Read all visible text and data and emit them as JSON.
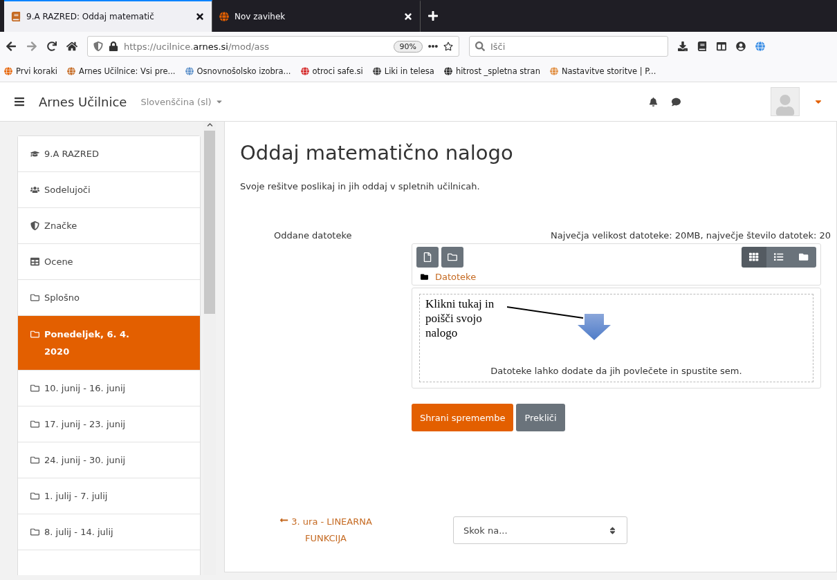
{
  "browser": {
    "tabs": [
      {
        "title": "9.A RAZRED: Oddaj matematič",
        "selected": true
      },
      {
        "title": "Nov zavihek",
        "selected": false
      }
    ],
    "address": {
      "prefix": "https://ucilnice.",
      "domain": "arnes.si",
      "path": "/mod/ass"
    },
    "zoom": "90%",
    "search": {
      "placeholder": "Išči"
    },
    "bookmarks": [
      "Prvi koraki",
      "Arnes Učilnice: Vsi pre...",
      "Osnovnošolsko izobra...",
      "otroci safe.si",
      "Liki in telesa",
      "hitrost _spletna stran",
      "Nastavitve storitve | P..."
    ]
  },
  "navbar": {
    "site_name": "Arnes Učilnice",
    "language": "Slovenščina (sl)"
  },
  "sidebar": {
    "items": [
      {
        "label": "9.A RAZRED",
        "kind": "course",
        "selected": false
      },
      {
        "label": "Sodelujoči",
        "kind": "participants",
        "selected": false
      },
      {
        "label": "Značke",
        "kind": "badges",
        "selected": false
      },
      {
        "label": "Ocene",
        "kind": "grades",
        "selected": false
      },
      {
        "label": "Splošno",
        "kind": "section",
        "selected": false
      },
      {
        "label": "Ponedeljek, 6. 4. 2020",
        "kind": "section",
        "selected": true
      },
      {
        "label": "10. junij - 16. junij",
        "kind": "section",
        "selected": false
      },
      {
        "label": "17. junij - 23. junij",
        "kind": "section",
        "selected": false
      },
      {
        "label": "24. junij - 30. junij",
        "kind": "section",
        "selected": false
      },
      {
        "label": "1. julij - 7. julij",
        "kind": "section",
        "selected": false
      },
      {
        "label": "8. julij - 14. julij",
        "kind": "section",
        "selected": false
      }
    ]
  },
  "main": {
    "title": "Oddaj matematično nalogo",
    "description": "Svoje rešitve poslikaj in jih oddaj v spletnih učilnicah.",
    "files_label": "Oddane datoteke",
    "limits": "Največja velikost datoteke: 20MB, največje število datotek: 20",
    "views": [
      {
        "kind": "grid",
        "selected": true
      },
      {
        "kind": "list",
        "selected": false
      },
      {
        "kind": "tree",
        "selected": false
      }
    ],
    "path": "Datoteke",
    "annotation": "Klikni tukaj in poišči svojo nalogo",
    "dropzone": "Datoteke lahko dodate da jih povlečete in spustite sem.",
    "buttons": [
      {
        "label": "Shrani spremembe",
        "kind": "primary"
      },
      {
        "label": "Prekliči",
        "kind": "secondary"
      }
    ],
    "prev_link": "3. ura - LINEARNA FUNKCIJA",
    "jump": {
      "placeholder": "Skok na..."
    }
  }
}
